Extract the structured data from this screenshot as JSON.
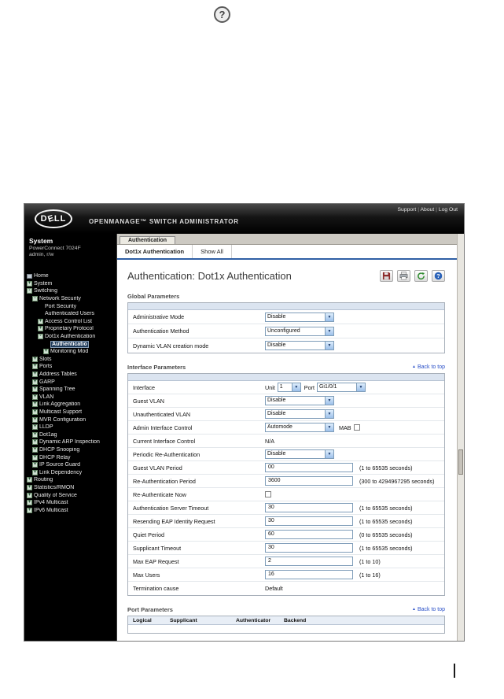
{
  "doc": {
    "help_icon": "?"
  },
  "ui": {
    "chevron": "▼",
    "plus": "+",
    "minus": "-",
    "back_top_arrow": "▲"
  },
  "header": {
    "logo": "DELL",
    "product": "OPENMANAGE™ SWITCH ADMINISTRATOR",
    "links": [
      "Support",
      "About",
      "Log Out"
    ]
  },
  "sidebar": {
    "system_title": "System",
    "device": "PowerConnect 7024F",
    "user": "admin, r/w",
    "items": [
      {
        "label": "Home",
        "level": 0,
        "exp": "home"
      },
      {
        "label": "System",
        "level": 0,
        "exp": "plus"
      },
      {
        "label": "Switching",
        "level": 0,
        "exp": "minus"
      },
      {
        "label": "Network Security",
        "level": 1,
        "exp": "minus"
      },
      {
        "label": "Port Security",
        "level": 2,
        "exp": "none"
      },
      {
        "label": "Authenticated Users",
        "level": 2,
        "exp": "none"
      },
      {
        "label": "Access Control List",
        "level": 2,
        "exp": "plus"
      },
      {
        "label": "Proprietary Protocol",
        "level": 2,
        "exp": "plus"
      },
      {
        "label": "Dot1x Authentication",
        "level": 2,
        "exp": "minus"
      },
      {
        "label": "Authenticatio",
        "level": 3,
        "exp": "none",
        "selected": true
      },
      {
        "label": "Monitoring Mod",
        "level": 3,
        "exp": "plus"
      },
      {
        "label": "Slots",
        "level": 1,
        "exp": "plus"
      },
      {
        "label": "Ports",
        "level": 1,
        "exp": "plus"
      },
      {
        "label": "Address Tables",
        "level": 1,
        "exp": "plus"
      },
      {
        "label": "GARP",
        "level": 1,
        "exp": "plus"
      },
      {
        "label": "Spanning Tree",
        "level": 1,
        "exp": "plus"
      },
      {
        "label": "VLAN",
        "level": 1,
        "exp": "plus"
      },
      {
        "label": "Link Aggregation",
        "level": 1,
        "exp": "plus"
      },
      {
        "label": "Multicast Support",
        "level": 1,
        "exp": "plus"
      },
      {
        "label": "MVR Configuration",
        "level": 1,
        "exp": "plus"
      },
      {
        "label": "LLDP",
        "level": 1,
        "exp": "plus"
      },
      {
        "label": "Dot1ag",
        "level": 1,
        "exp": "plus"
      },
      {
        "label": "Dynamic ARP Inspection",
        "level": 1,
        "exp": "plus"
      },
      {
        "label": "DHCP Snooping",
        "level": 1,
        "exp": "plus"
      },
      {
        "label": "DHCP Relay",
        "level": 1,
        "exp": "plus"
      },
      {
        "label": "IP Source Guard",
        "level": 1,
        "exp": "plus"
      },
      {
        "label": "Link Dependency",
        "level": 1,
        "exp": "plus"
      },
      {
        "label": "Routing",
        "level": 0,
        "exp": "plus"
      },
      {
        "label": "Statistics/RMON",
        "level": 0,
        "exp": "plus"
      },
      {
        "label": "Quality of Service",
        "level": 0,
        "exp": "plus"
      },
      {
        "label": "IPv4 Multicast",
        "level": 0,
        "exp": "plus"
      },
      {
        "label": "IPv6 Multicast",
        "level": 0,
        "exp": "plus"
      }
    ]
  },
  "tabs": {
    "primary": "Authentication",
    "secondary": [
      {
        "label": "Dot1x Authentication",
        "active": true
      },
      {
        "label": "Show All",
        "active": false
      }
    ]
  },
  "page": {
    "title": "Authentication: Dot1x Authentication",
    "toolbar_icons": [
      "save-icon",
      "print-icon",
      "refresh-icon",
      "help-icon"
    ]
  },
  "global_params": {
    "heading": "Global Parameters",
    "rows": [
      {
        "label": "Administrative Mode",
        "control": {
          "kind": "select",
          "value": "Disable"
        }
      },
      {
        "label": "Authentication Method",
        "control": {
          "kind": "select",
          "value": "Unconfigured"
        }
      },
      {
        "label": "Dynamic VLAN creation mode",
        "control": {
          "kind": "select",
          "value": "Disable"
        }
      }
    ]
  },
  "interface_params": {
    "heading": "Interface Parameters",
    "back_to_top": "Back to top",
    "rows": [
      {
        "label": "Interface",
        "control": {
          "kind": "interface",
          "unit_label": "Unit",
          "unit_value": "1",
          "port_label": "Port",
          "port_value": "Gi1/0/1"
        }
      },
      {
        "label": "Guest VLAN",
        "control": {
          "kind": "select",
          "value": "Disable"
        }
      },
      {
        "label": "Unauthenticated VLAN",
        "control": {
          "kind": "select",
          "value": "Disable"
        }
      },
      {
        "label": "Admin Interface Control",
        "control": {
          "kind": "select_checkbox",
          "value": "Automode",
          "checkbox_label": "MAB",
          "checked": false
        }
      },
      {
        "label": "Current Interface Control",
        "control": {
          "kind": "text",
          "value": "N/A"
        }
      },
      {
        "label": "Periodic Re-Authentication",
        "control": {
          "kind": "select",
          "value": "Disable"
        }
      },
      {
        "label": "Guest VLAN Period",
        "control": {
          "kind": "input",
          "value": "00"
        },
        "hint": "(1 to 65535 seconds)"
      },
      {
        "label": "Re-Authentication Period",
        "control": {
          "kind": "input",
          "value": "3600"
        },
        "hint": "(300 to 4294967295 seconds)"
      },
      {
        "label": "Re-Authenticate Now",
        "control": {
          "kind": "checkbox",
          "checked": false
        }
      },
      {
        "label": "Authentication Server Timeout",
        "control": {
          "kind": "input",
          "value": "30"
        },
        "hint": "(1 to 65535 seconds)"
      },
      {
        "label": "Resending EAP Identity Request",
        "control": {
          "kind": "input",
          "value": "30"
        },
        "hint": "(1 to 65535 seconds)"
      },
      {
        "label": "Quiet Period",
        "control": {
          "kind": "input",
          "value": "60"
        },
        "hint": "(0 to 65535 seconds)"
      },
      {
        "label": "Supplicant Timeout",
        "control": {
          "kind": "input",
          "value": "30"
        },
        "hint": "(1 to 65535 seconds)"
      },
      {
        "label": "Max EAP Request",
        "control": {
          "kind": "input",
          "value": "2"
        },
        "hint": "(1 to 10)"
      },
      {
        "label": "Max Users",
        "control": {
          "kind": "input",
          "value": "16"
        },
        "hint": "(1 to 16)"
      },
      {
        "label": "Termination cause",
        "control": {
          "kind": "text",
          "value": "Default"
        }
      }
    ]
  },
  "port_params": {
    "heading": "Port Parameters",
    "back_to_top": "Back to top",
    "columns": [
      "Logical",
      "Supplicant",
      "Authenticator",
      "Backend"
    ]
  }
}
